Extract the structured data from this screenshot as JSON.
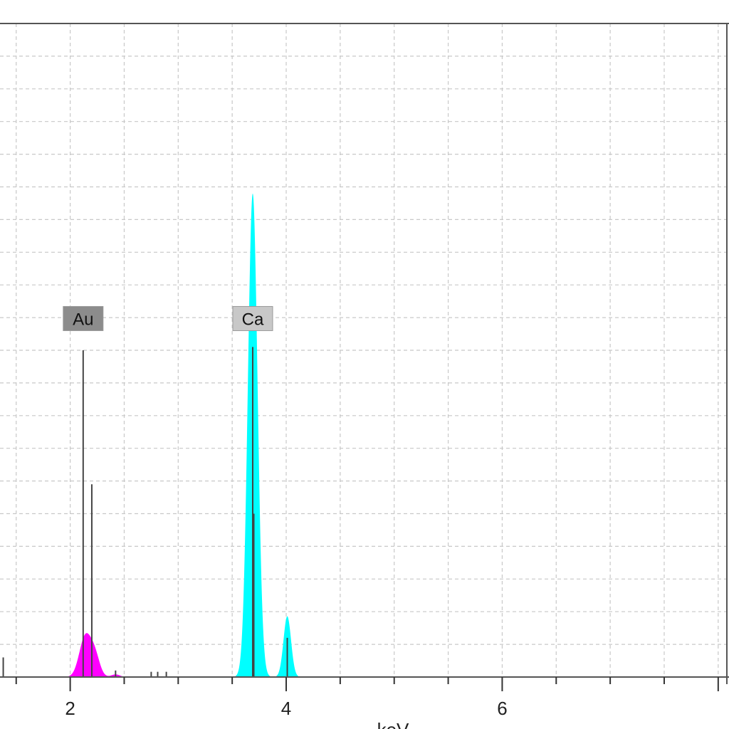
{
  "chart_data": {
    "type": "area",
    "xlabel": "keV",
    "ylabel": "",
    "xlim": [
      1.35,
      8.1
    ],
    "ylim": [
      0,
      1.0
    ],
    "x_ticks": [
      2,
      4,
      6
    ],
    "x_minor_step": 0.5,
    "grid": true,
    "series": [
      {
        "name": "Au",
        "color": "#ff00ff",
        "peaks": [
          {
            "center": 2.14,
            "height": 0.062,
            "sigma": 0.055
          },
          {
            "center": 2.23,
            "height": 0.03,
            "sigma": 0.045
          },
          {
            "center": 2.42,
            "height": 0.004,
            "sigma": 0.04
          }
        ],
        "x_range": [
          1.8,
          2.55
        ]
      },
      {
        "name": "Ca",
        "color": "#00ffff",
        "peaks": [
          {
            "center": 3.69,
            "height": 0.74,
            "sigma": 0.045
          },
          {
            "center": 4.01,
            "height": 0.093,
            "sigma": 0.035
          }
        ],
        "x_range": [
          3.5,
          4.2
        ]
      }
    ],
    "marker_lines": [
      {
        "x": 2.12,
        "height": 0.5
      },
      {
        "x": 2.2,
        "height": 0.295
      },
      {
        "x": 3.69,
        "height": 0.505
      },
      {
        "x": 3.7,
        "height": 0.25
      },
      {
        "x": 4.01,
        "height": 0.06
      },
      {
        "x": 1.38,
        "height": 0.03
      },
      {
        "x": 2.42,
        "height": 0.01
      },
      {
        "x": 2.75,
        "height": 0.008
      },
      {
        "x": 2.81,
        "height": 0.008
      },
      {
        "x": 2.89,
        "height": 0.008
      }
    ],
    "labels": [
      {
        "text": "Au",
        "x": 2.12,
        "y": 0.53,
        "fill": "#8c8c8c"
      },
      {
        "text": "Ca",
        "x": 3.69,
        "y": 0.53,
        "fill": "#c8c8c8"
      }
    ]
  }
}
